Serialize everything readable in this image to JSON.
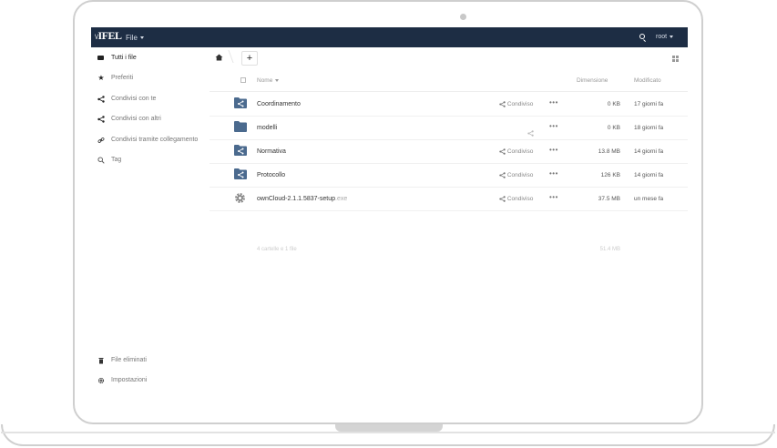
{
  "header": {
    "logo": "IFEL",
    "app_menu": "File",
    "user_menu": "root",
    "colors": {
      "bar": "#1d2d44",
      "folder": "#4b6a8e"
    }
  },
  "sidebar": {
    "items": [
      {
        "label": "Tutti i file",
        "icon": "folder-icon",
        "active": true
      },
      {
        "label": "Preferiti",
        "icon": "star-icon"
      },
      {
        "label": "Condivisi con te",
        "icon": "share-icon"
      },
      {
        "label": "Condivisi con altri",
        "icon": "share-icon"
      },
      {
        "label": "Condivisi tramite collegamento",
        "icon": "link-icon"
      },
      {
        "label": "Tag",
        "icon": "search-icon"
      }
    ],
    "bottom": [
      {
        "label": "File eliminati",
        "icon": "trash-icon"
      },
      {
        "label": "Impostazioni",
        "icon": "gear-icon"
      }
    ]
  },
  "toolbar": {
    "new_label": "+"
  },
  "table": {
    "columns": {
      "name": "Nome",
      "size": "Dimensione",
      "modified": "Modificato"
    },
    "rows": [
      {
        "name": "Coordinamento",
        "ext": "",
        "type": "shared-folder",
        "share": "Condiviso",
        "size": "0 KB",
        "modified": "17 giorni fa"
      },
      {
        "name": "modelli",
        "ext": "",
        "type": "folder",
        "share": "",
        "size": "0 KB",
        "modified": "18 giorni fa"
      },
      {
        "name": "Normativa",
        "ext": "",
        "type": "shared-folder",
        "share": "Condiviso",
        "size": "13.8 MB",
        "modified": "14 giorni fa"
      },
      {
        "name": "Protocollo",
        "ext": "",
        "type": "shared-folder",
        "share": "Condiviso",
        "size": "126 KB",
        "modified": "14 giorni fa"
      },
      {
        "name": "ownCloud-2.1.1.5837-setup",
        "ext": ".exe",
        "type": "file-gear",
        "share": "Condiviso",
        "size": "37.5 MB",
        "modified": "un mese fa"
      }
    ],
    "summary": "4 cartelle e 1 file",
    "summary_size": "51.4 MB"
  }
}
